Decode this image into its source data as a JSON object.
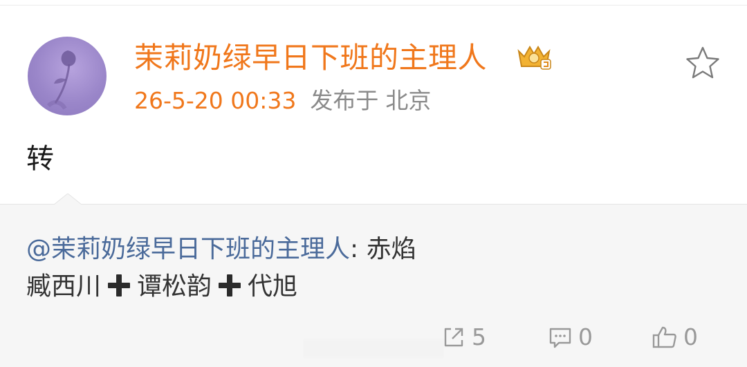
{
  "post": {
    "author": "茉莉奶绿早日下班的主理人",
    "timestamp": "26-5-20 00:33",
    "location_prefix": "发布于",
    "location": "北京",
    "text": "转"
  },
  "repost": {
    "mention": "@茉莉奶绿早日下班的主理人",
    "separator": ": ",
    "line1_text": "赤焰",
    "line2_parts": [
      "臧西川",
      "谭松韵",
      "代旭"
    ]
  },
  "actions": {
    "repost_count": "5",
    "comment_count": "0",
    "like_count": "0"
  },
  "colors": {
    "accent": "#f0771b",
    "mention": "#4a6a9a",
    "muted": "#999999"
  },
  "icons": {
    "vip": "vip-crown-badge-icon",
    "favorite": "star-outline-icon",
    "plus": "heavy-plus-sign-emoji",
    "repost": "share-arrow-icon",
    "comment": "comment-bubble-icon",
    "like": "thumbs-up-icon"
  }
}
